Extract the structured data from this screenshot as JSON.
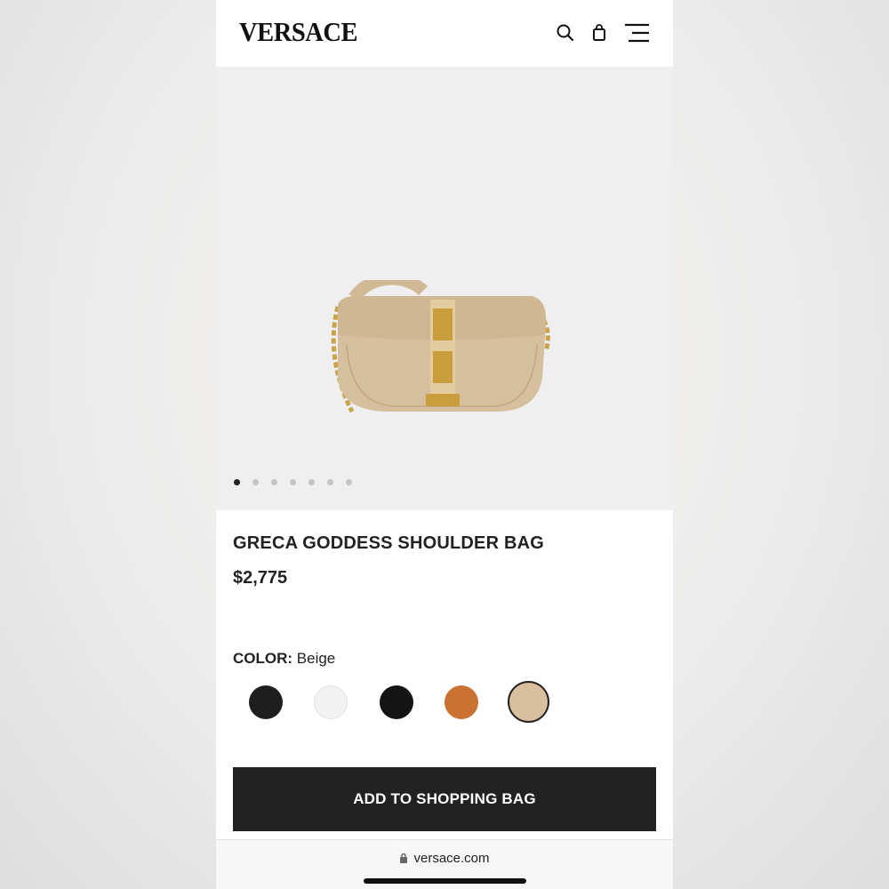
{
  "brand": {
    "logo_text": "VERSACE"
  },
  "header": {
    "icons": [
      "search-icon",
      "shopping-bag-icon",
      "menu-icon"
    ]
  },
  "gallery": {
    "image": "beige-shoulder-bag",
    "slide_count": 7,
    "active_slide": 1
  },
  "product": {
    "name": "GRECA GODDESS SHOULDER BAG",
    "price": "$2,775"
  },
  "color_selector": {
    "label": "COLOR:",
    "selected": "Beige",
    "swatch_colors": [
      "#1e1e1e",
      "#f2f2f2",
      "#141414",
      "#c97233",
      "#d8bf9e"
    ],
    "selected_index": 4
  },
  "cta": {
    "add_label": "ADD TO SHOPPING BAG"
  },
  "browser": {
    "url": "versace.com"
  }
}
